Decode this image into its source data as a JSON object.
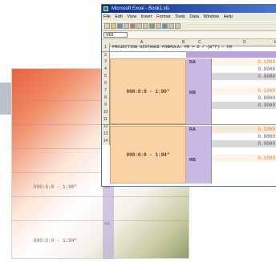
{
  "window": {
    "title": "Microsoft Excel - Book1.xls",
    "menus": [
      "File",
      "Edit",
      "View",
      "Insert",
      "Format",
      "Tools",
      "Data",
      "Window",
      "Help"
    ],
    "name_box": "VE5",
    "column_headers": [
      "A",
      "B",
      "C",
      "D",
      "E"
    ],
    "row_numbers": [
      "1",
      "2",
      "3",
      "4",
      "5",
      "6",
      "7",
      "8",
      "9",
      "10",
      "11",
      "12",
      "13",
      "14"
    ]
  },
  "sheet": {
    "formula_text": "PROJECTION DISTANCE FORMULA: PD = D / (W*T) - CM",
    "block1_label": "000:0:0 - 1:90\"",
    "block2_label": "000:0:0 - 1:94\"",
    "group_labels": [
      "RA",
      "RB",
      "RA",
      "RB"
    ],
    "values": [
      {
        "text": "0.1000",
        "style": "orange"
      },
      {
        "text": "0.0000",
        "style": "white"
      },
      {
        "text": "0.0000",
        "style": "gray"
      },
      {
        "text": "0.1000",
        "style": "orange"
      },
      {
        "text": "0.0000",
        "style": "white"
      },
      {
        "text": "0.0000",
        "style": "gray"
      },
      {
        "text": "0.1000",
        "style": "tan"
      },
      {
        "text": "0.0000",
        "style": "white"
      },
      {
        "text": "0.0000",
        "style": "gray"
      },
      {
        "text": "0.1000",
        "style": "orange"
      }
    ]
  },
  "back_sheet": {
    "label1": "000:0:0 - 1:90\"",
    "label2": "000:0:0 - 1:94\""
  },
  "colors": {
    "peach": "#fbd3a6",
    "violet": "#c9b8e2",
    "orange_value": "#f07a2a",
    "title_blue": "#0a2f8a"
  }
}
